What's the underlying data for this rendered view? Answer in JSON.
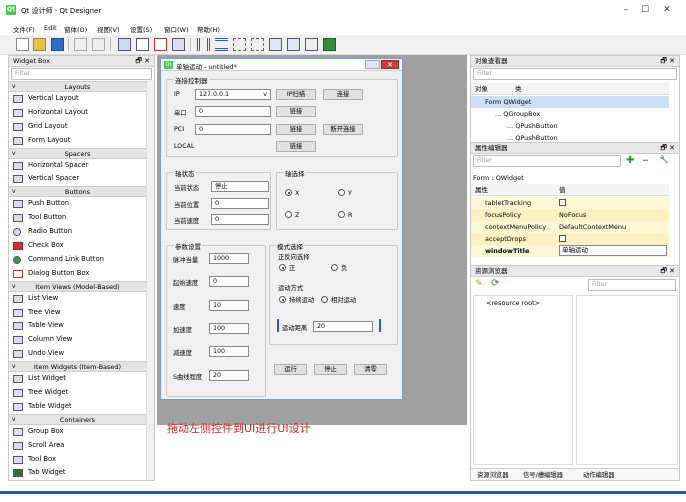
{
  "window": {
    "title": "Qt 设计师 - Qt Designer",
    "icon_text": "Qt",
    "minimize_glyph": "–",
    "maximize_glyph": "☐",
    "close_glyph": "✕"
  },
  "menu": [
    "文件(F)",
    "Edit",
    "窗体(O)",
    "视图(V)",
    "设置(S)",
    "窗口(W)",
    "帮助(H)"
  ],
  "widget_box": {
    "title": "Widget Box",
    "float_glyph": "🗗",
    "close_glyph": "✕",
    "filter_placeholder": "Filter",
    "sections": [
      {
        "name": "Layouts",
        "items": [
          "Vertical Layout",
          "Horizontal Layout",
          "Grid Layout",
          "Form Layout"
        ]
      },
      {
        "name": "Spacers",
        "items": [
          "Horizontal Spacer",
          "Vertical Spacer"
        ]
      },
      {
        "name": "Buttons",
        "items": [
          "Push Button",
          "Tool Button",
          "Radio Button",
          "Check Box",
          "Command Link Button",
          "Dialog Button Box"
        ]
      },
      {
        "name": "Item Views (Model-Based)",
        "items": [
          "List View",
          "Tree View",
          "Table View",
          "Column View",
          "Undo View"
        ]
      },
      {
        "name": "Item Widgets (Item-Based)",
        "items": [
          "List Widget",
          "Tree Widget",
          "Table Widget"
        ]
      },
      {
        "name": "Containers",
        "items": [
          "Group Box",
          "Scroll Area",
          "Tool Box",
          "Tab Widget"
        ]
      }
    ]
  },
  "form": {
    "title": "单轴运动 - untitled*",
    "connect": {
      "group": "连接控制器",
      "ip_label": "IP",
      "ip_value": "127.0.0.1",
      "ip_scan": "IP扫描",
      "connect_btn": "连接",
      "serial_label": "串口",
      "serial_value": "0",
      "serial_link": "链接",
      "pci_label": "PCI",
      "pci_value": "0",
      "pci_link": "链接",
      "disconnect": "断开连接",
      "local_label": "LOCAL",
      "local_link": "链接"
    },
    "axis_status": {
      "group": "轴状态",
      "state_label": "当前状态",
      "state_value": "停止",
      "pos_label": "当前位置",
      "pos_value": "0",
      "speed_label": "当前速度",
      "speed_value": "0"
    },
    "axis_select": {
      "group": "轴选择",
      "x": "X",
      "y": "Y",
      "z": "Z",
      "r": "R"
    },
    "params": {
      "group": "参数设置",
      "pulse_label": "脉冲当量",
      "pulse_value": "1000",
      "start_label": "起始速度",
      "start_value": "0",
      "speed_label": "速度",
      "speed_value": "10",
      "accel_label": "加速度",
      "accel_value": "100",
      "decel_label": "减速度",
      "decel_value": "100",
      "scurve_label": "S曲线程度",
      "scurve_value": "20"
    },
    "mode": {
      "group": "模式选择",
      "dir_label": "正反向选择",
      "pos": "正",
      "neg": "负",
      "motion_label": "运动方式",
      "continuous": "持续运动",
      "relative": "相对运动",
      "distance_label": "运动距离",
      "distance_value": "20"
    },
    "run": "运行",
    "stop": "停止",
    "clear": "清零"
  },
  "hint": "拖动左侧控件到UI进行UI设计",
  "object_inspector": {
    "title": "对象查看器",
    "float_glyph": "🗗",
    "close_glyph": "✕",
    "filter_placeholder": "Filter",
    "col_object": "对象",
    "col_class": "类",
    "rows": [
      "Form QWidget",
      "... QGroupBox",
      "... QPushButton",
      "... QPushButton"
    ]
  },
  "property_editor": {
    "title": "属性编辑器",
    "float_glyph": "🗗",
    "close_glyph": "✕",
    "filter_placeholder": "Filter",
    "add_glyph": "✚",
    "remove_glyph": "━",
    "tool_glyph": "🔧",
    "object_line": "Form : QWidget",
    "col_prop": "属性",
    "col_value": "值",
    "rows": [
      {
        "name": "tabletTracking",
        "value": ""
      },
      {
        "name": "focusPolicy",
        "value": "NoFocus"
      },
      {
        "name": "contextMenuPolicy",
        "value": "DefaultContextMenu"
      },
      {
        "name": "acceptDrops",
        "value": ""
      },
      {
        "name": "windowTitle",
        "value": "单轴运动"
      }
    ]
  },
  "resource_browser": {
    "title": "资源浏览器",
    "float_glyph": "🗗",
    "close_glyph": "✕",
    "edit_glyph": "✎",
    "reload_glyph": "⟳",
    "filter_placeholder": "Filter",
    "root": "<resource root>",
    "tabs": [
      "资源浏览器",
      "信号/槽编辑器",
      "动作编辑器"
    ]
  }
}
